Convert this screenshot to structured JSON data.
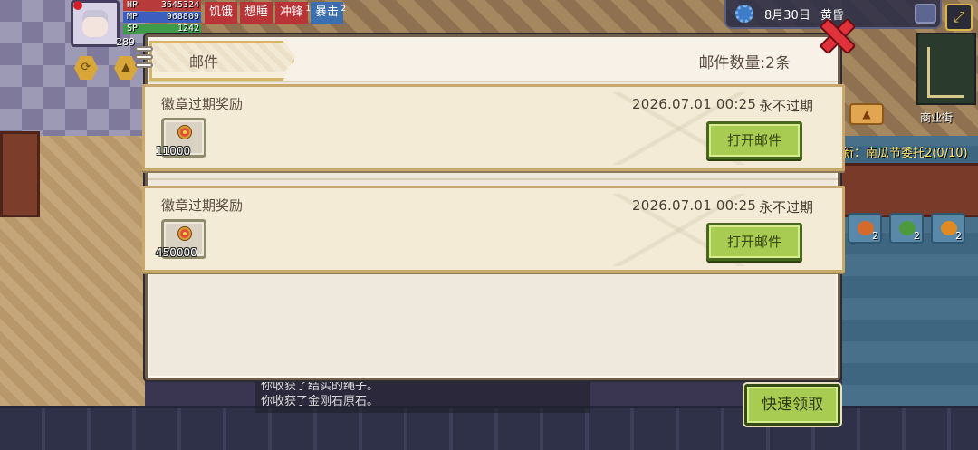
{
  "hud": {
    "hp_label": "HP",
    "hp_value": "3645324",
    "mp_label": "MP",
    "mp_value": "968809",
    "sp_label": "SP",
    "sp_value": "1242",
    "level": "289",
    "status_tags": [
      {
        "label": "饥饿",
        "sup": "",
        "color": "red"
      },
      {
        "label": "想睡",
        "sup": "",
        "color": "red"
      },
      {
        "label": "冲锋",
        "sup": "1",
        "color": "red"
      },
      {
        "label": "暴击",
        "sup": "2",
        "color": "blue"
      }
    ]
  },
  "topbar": {
    "date": "8月30日",
    "time_of_day": "黄昏"
  },
  "map": {
    "label": "商业街"
  },
  "quest": {
    "text": "新：南瓜节委托2(0/10)"
  },
  "inventory_counts": [
    "2",
    "2",
    "2"
  ],
  "chat_log": [
    "你收获了结实的绳子。",
    "你收获了金刚石原石。"
  ],
  "mail": {
    "tab_title": "邮件",
    "count_text": "邮件数量:2条",
    "items": [
      {
        "subject": "徽章过期奖励",
        "date": "2026.07.01 00:25",
        "expiry": "永不过期",
        "attachment_qty": "11000",
        "open_label": "打开邮件"
      },
      {
        "subject": "徽章过期奖励",
        "date": "2026.07.01 00:25",
        "expiry": "永不过期",
        "attachment_qty": "450000",
        "open_label": "打开邮件"
      }
    ],
    "quick_claim_label": "快速领取"
  },
  "colors": {
    "accent_green": "#a8cc52",
    "close_red": "#e0323a",
    "panel_bg": "#efe8dc",
    "quest_yellow": "#ffe46a"
  }
}
